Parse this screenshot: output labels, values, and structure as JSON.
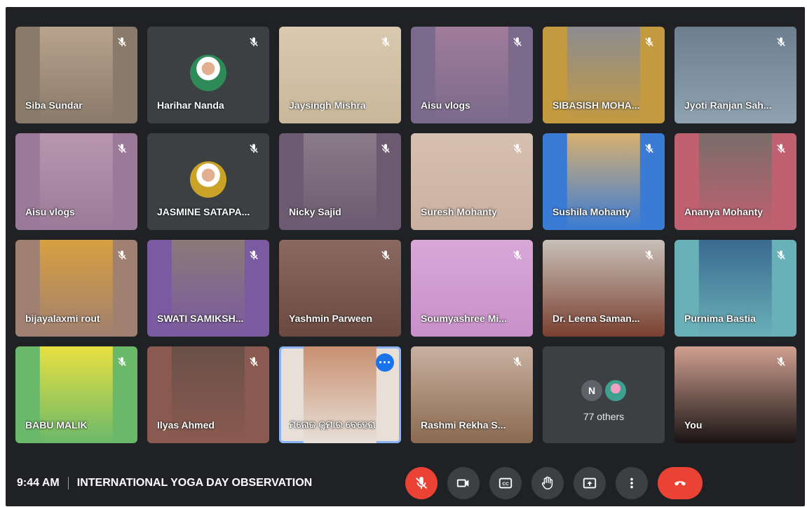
{
  "meeting": {
    "time": "9:44 AM",
    "title": "INTERNATIONAL YOGA DAY OBSERVATION"
  },
  "participants": [
    {
      "name": "Siba Sundar",
      "bg": "#8a7a6a",
      "photo": "#b8a48e",
      "muted": true
    },
    {
      "name": "Harihar Nanda",
      "avatar": true,
      "avatar_color": "#2e8b57",
      "muted": true
    },
    {
      "name": "Jaysingh Mishra",
      "bg": "#c9b79a",
      "photo": "#d8c9b0",
      "wide": true,
      "muted": true
    },
    {
      "name": "Aisu vlogs",
      "bg": "#7b6a8c",
      "photo": "#a07c9a",
      "muted": true
    },
    {
      "name": "SIBASISH MOHA...",
      "bg": "#c49a40",
      "photo": "#8c8c90",
      "muted": true
    },
    {
      "name": "Jyoti Ranjan Sah...",
      "bg": "#8ea2b0",
      "photo": "#6d7f8e",
      "wide": true,
      "muted": true
    },
    {
      "name": "Aisu vlogs",
      "bg": "#9a7a98",
      "photo": "#b896b0",
      "muted": true
    },
    {
      "name": "JASMINE SATAPA...",
      "avatar": true,
      "avatar_color": "#c9a227",
      "muted": true
    },
    {
      "name": "Nicky Sajid",
      "bg": "#6b5a70",
      "photo": "#8a7b8a",
      "muted": true
    },
    {
      "name": "Suresh Mohanty",
      "bg": "#c9b0a0",
      "photo": "#d8c0b0",
      "wide": true,
      "muted": true
    },
    {
      "name": "Sushila Mohanty",
      "bg": "#3a7bd5",
      "photo": "#d8b070",
      "muted": true
    },
    {
      "name": "Ananya Mohanty",
      "bg": "#c06070",
      "photo": "#7a6d6a",
      "muted": true
    },
    {
      "name": "bijayalaxmi rout",
      "bg": "#a08070",
      "photo": "#d8a040",
      "muted": true
    },
    {
      "name": "SWATI SAMIKSH...",
      "bg": "#7a5aa0",
      "photo": "#8a7a78",
      "muted": true
    },
    {
      "name": "Yashmin Parween",
      "bg": "#6a4a40",
      "photo": "#8a6a60",
      "wide": true,
      "muted": true
    },
    {
      "name": "Soumyashree Mi...",
      "bg": "#c890c8",
      "photo": "#d8a8d8",
      "wide": true,
      "muted": true
    },
    {
      "name": "Dr. Leena Saman...",
      "bg": "#7a4030",
      "photo": "#c8c0b8",
      "wide": true,
      "muted": true
    },
    {
      "name": "Purnima Bastia",
      "bg": "#6ab0b8",
      "photo": "#3a6a90",
      "muted": true
    },
    {
      "name": "BABU MALIK",
      "bg": "#6ab86a",
      "photo": "#e8e040",
      "muted": true
    },
    {
      "name": "Ilyas Ahmed",
      "bg": "#8a5a50",
      "photo": "#6a5048",
      "muted": true
    },
    {
      "name": "ମନୋଜ କୁମାର ବେହେରା",
      "bg": "#e8e0d8",
      "photo": "#c89070",
      "active": true
    },
    {
      "name": "Rashmi Rekha S...",
      "bg": "#8a6a50",
      "photo": "#c8b0a0",
      "wide": true,
      "muted": true
    },
    {
      "others": true,
      "label": "77 others",
      "initial": "N",
      "initial_color": "#5f6368"
    },
    {
      "name": "You",
      "bg": "#1a1414",
      "photo": "#d0a090",
      "wide": true,
      "muted": true
    }
  ],
  "controls": {
    "mic": "mic-off",
    "camera": "camera",
    "captions": "captions",
    "hand": "raise-hand",
    "present": "present",
    "more": "more",
    "hangup": "hang-up"
  }
}
